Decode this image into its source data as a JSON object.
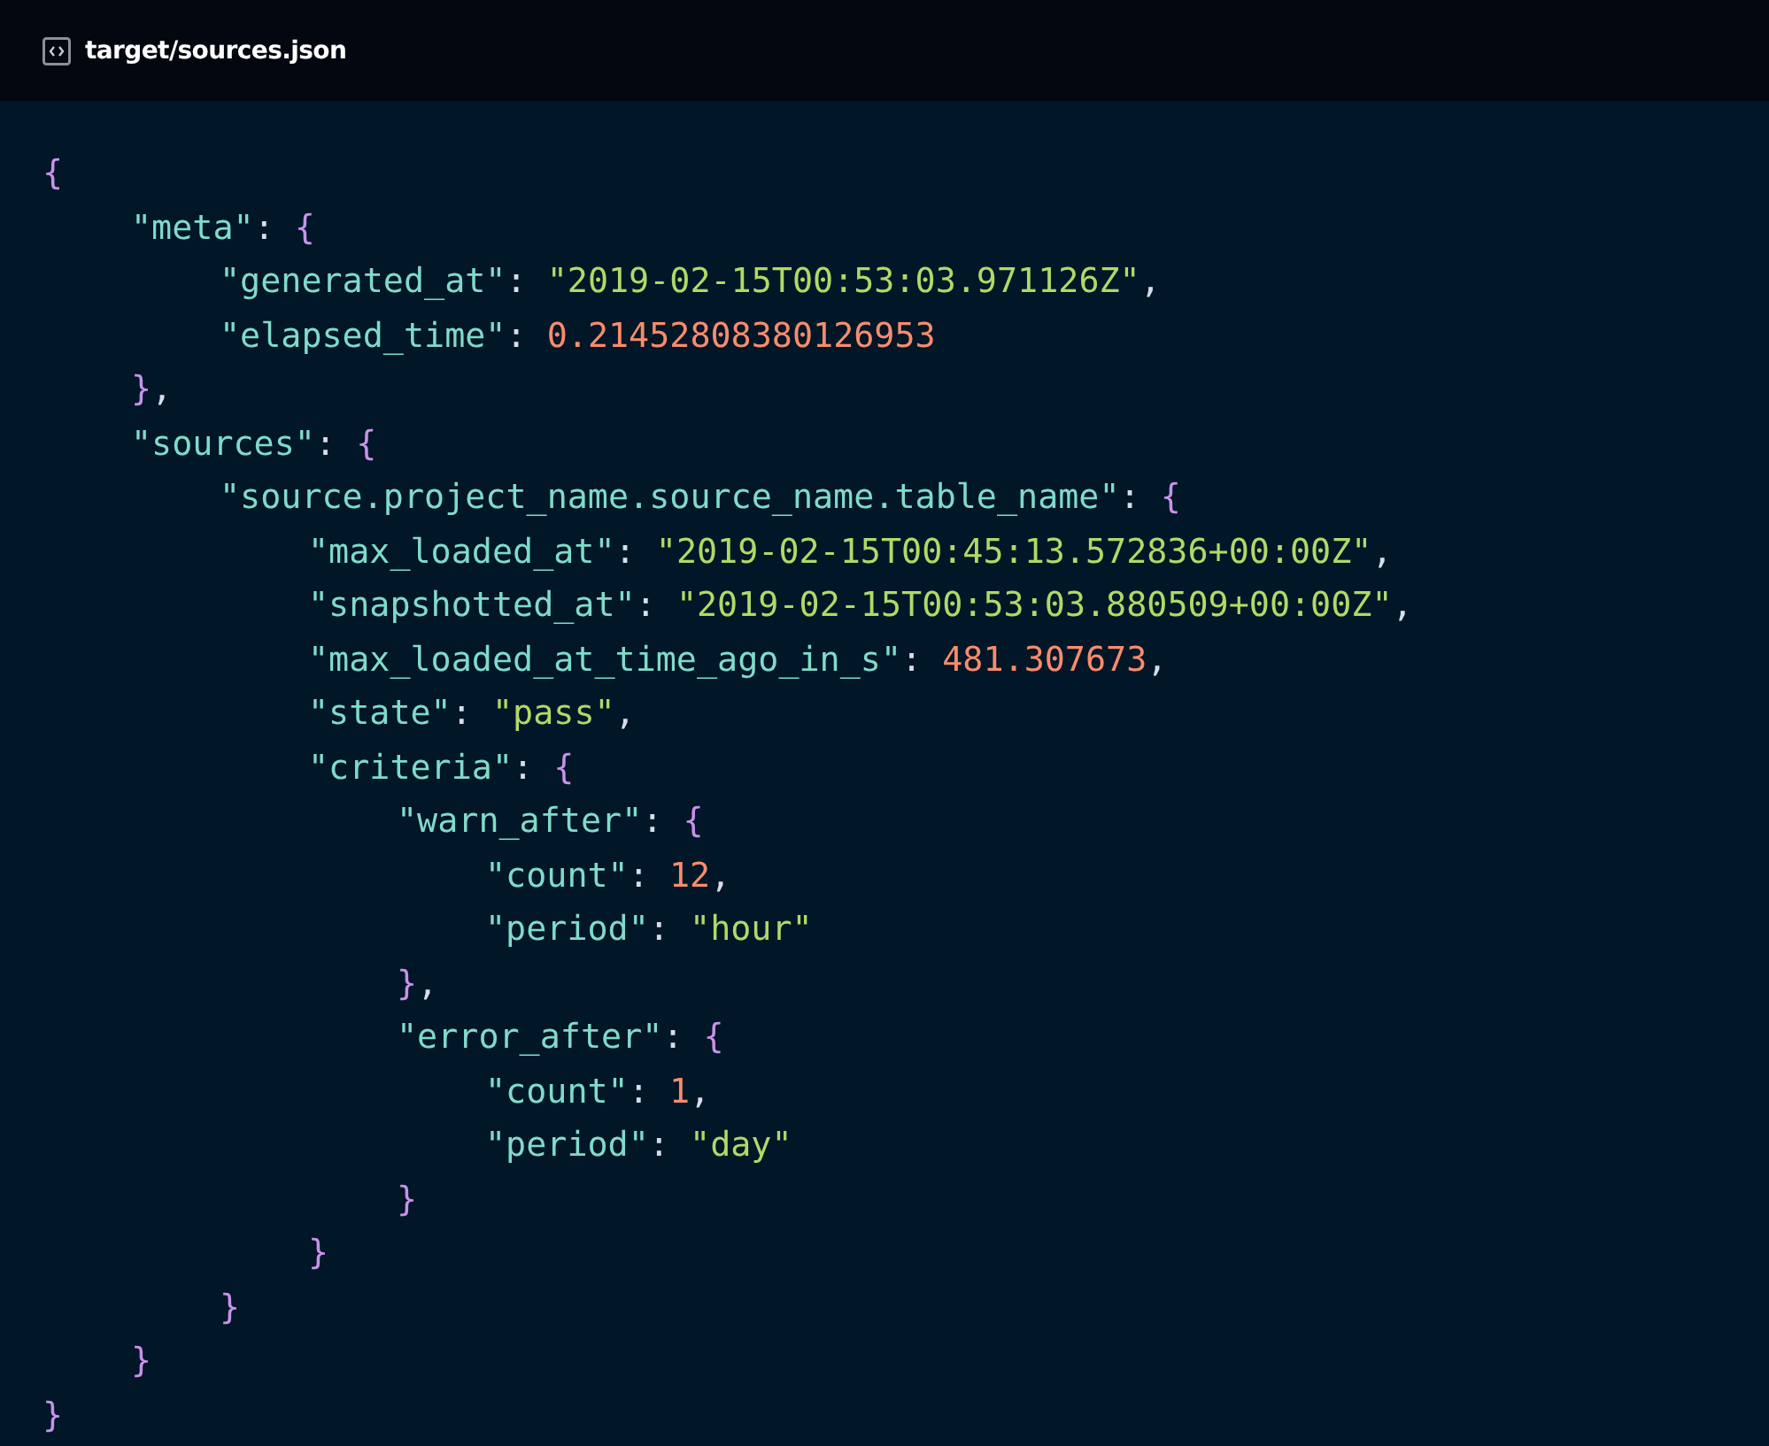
{
  "header": {
    "filename": "target/sources.json"
  },
  "code": [
    {
      "tokens": [
        {
          "kind": "brace",
          "text": "{"
        }
      ],
      "children": [
        {
          "tokens": [
            {
              "kind": "key",
              "text": "\"meta\""
            },
            {
              "kind": "punct",
              "text": ": "
            },
            {
              "kind": "brace",
              "text": "{"
            }
          ],
          "children": [
            {
              "tokens": [
                {
                  "kind": "key",
                  "text": "\"generated_at\""
                },
                {
                  "kind": "punct",
                  "text": ": "
                },
                {
                  "kind": "string",
                  "text": "\"2019-02-15T00:53:03.971126Z\""
                },
                {
                  "kind": "punct",
                  "text": ","
                }
              ]
            },
            {
              "tokens": [
                {
                  "kind": "key",
                  "text": "\"elapsed_time\""
                },
                {
                  "kind": "punct",
                  "text": ": "
                },
                {
                  "kind": "number",
                  "text": "0.21452808380126953"
                }
              ]
            }
          ]
        },
        {
          "tokens": [
            {
              "kind": "brace",
              "text": "}"
            },
            {
              "kind": "punct",
              "text": ","
            }
          ]
        },
        {
          "tokens": [
            {
              "kind": "key",
              "text": "\"sources\""
            },
            {
              "kind": "punct",
              "text": ": "
            },
            {
              "kind": "brace",
              "text": "{"
            }
          ],
          "children": [
            {
              "tokens": [
                {
                  "kind": "key",
                  "text": "\"source.project_name.source_name.table_name\""
                },
                {
                  "kind": "punct",
                  "text": ": "
                },
                {
                  "kind": "brace",
                  "text": "{"
                }
              ],
              "children": [
                {
                  "tokens": [
                    {
                      "kind": "key",
                      "text": "\"max_loaded_at\""
                    },
                    {
                      "kind": "punct",
                      "text": ": "
                    },
                    {
                      "kind": "string",
                      "text": "\"2019-02-15T00:45:13.572836+00:00Z\""
                    },
                    {
                      "kind": "punct",
                      "text": ","
                    }
                  ]
                },
                {
                  "tokens": [
                    {
                      "kind": "key",
                      "text": "\"snapshotted_at\""
                    },
                    {
                      "kind": "punct",
                      "text": ": "
                    },
                    {
                      "kind": "string",
                      "text": "\"2019-02-15T00:53:03.880509+00:00Z\""
                    },
                    {
                      "kind": "punct",
                      "text": ","
                    }
                  ]
                },
                {
                  "tokens": [
                    {
                      "kind": "key",
                      "text": "\"max_loaded_at_time_ago_in_s\""
                    },
                    {
                      "kind": "punct",
                      "text": ": "
                    },
                    {
                      "kind": "number",
                      "text": "481.307673"
                    },
                    {
                      "kind": "punct",
                      "text": ","
                    }
                  ]
                },
                {
                  "tokens": [
                    {
                      "kind": "key",
                      "text": "\"state\""
                    },
                    {
                      "kind": "punct",
                      "text": ": "
                    },
                    {
                      "kind": "string",
                      "text": "\"pass\""
                    },
                    {
                      "kind": "punct",
                      "text": ","
                    }
                  ]
                },
                {
                  "tokens": [
                    {
                      "kind": "key",
                      "text": "\"criteria\""
                    },
                    {
                      "kind": "punct",
                      "text": ": "
                    },
                    {
                      "kind": "brace",
                      "text": "{"
                    }
                  ],
                  "children": [
                    {
                      "tokens": [
                        {
                          "kind": "key",
                          "text": "\"warn_after\""
                        },
                        {
                          "kind": "punct",
                          "text": ": "
                        },
                        {
                          "kind": "brace",
                          "text": "{"
                        }
                      ],
                      "children": [
                        {
                          "tokens": [
                            {
                              "kind": "key",
                              "text": "\"count\""
                            },
                            {
                              "kind": "punct",
                              "text": ": "
                            },
                            {
                              "kind": "number",
                              "text": "12"
                            },
                            {
                              "kind": "punct",
                              "text": ","
                            }
                          ]
                        },
                        {
                          "tokens": [
                            {
                              "kind": "key",
                              "text": "\"period\""
                            },
                            {
                              "kind": "punct",
                              "text": ": "
                            },
                            {
                              "kind": "string",
                              "text": "\"hour\""
                            }
                          ]
                        }
                      ]
                    },
                    {
                      "tokens": [
                        {
                          "kind": "brace",
                          "text": "}"
                        },
                        {
                          "kind": "punct",
                          "text": ","
                        }
                      ]
                    },
                    {
                      "tokens": [
                        {
                          "kind": "key",
                          "text": "\"error_after\""
                        },
                        {
                          "kind": "punct",
                          "text": ": "
                        },
                        {
                          "kind": "brace",
                          "text": "{"
                        }
                      ],
                      "children": [
                        {
                          "tokens": [
                            {
                              "kind": "key",
                              "text": "\"count\""
                            },
                            {
                              "kind": "punct",
                              "text": ": "
                            },
                            {
                              "kind": "number",
                              "text": "1"
                            },
                            {
                              "kind": "punct",
                              "text": ","
                            }
                          ]
                        },
                        {
                          "tokens": [
                            {
                              "kind": "key",
                              "text": "\"period\""
                            },
                            {
                              "kind": "punct",
                              "text": ": "
                            },
                            {
                              "kind": "string",
                              "text": "\"day\""
                            }
                          ]
                        }
                      ]
                    },
                    {
                      "tokens": [
                        {
                          "kind": "brace",
                          "text": "}"
                        }
                      ]
                    }
                  ]
                },
                {
                  "tokens": [
                    {
                      "kind": "brace",
                      "text": "}"
                    }
                  ]
                }
              ]
            },
            {
              "tokens": [
                {
                  "kind": "brace",
                  "text": "}"
                }
              ]
            }
          ]
        },
        {
          "tokens": [
            {
              "kind": "brace",
              "text": "}"
            }
          ]
        }
      ]
    },
    {
      "tokens": [
        {
          "kind": "brace",
          "text": "}"
        }
      ]
    }
  ]
}
